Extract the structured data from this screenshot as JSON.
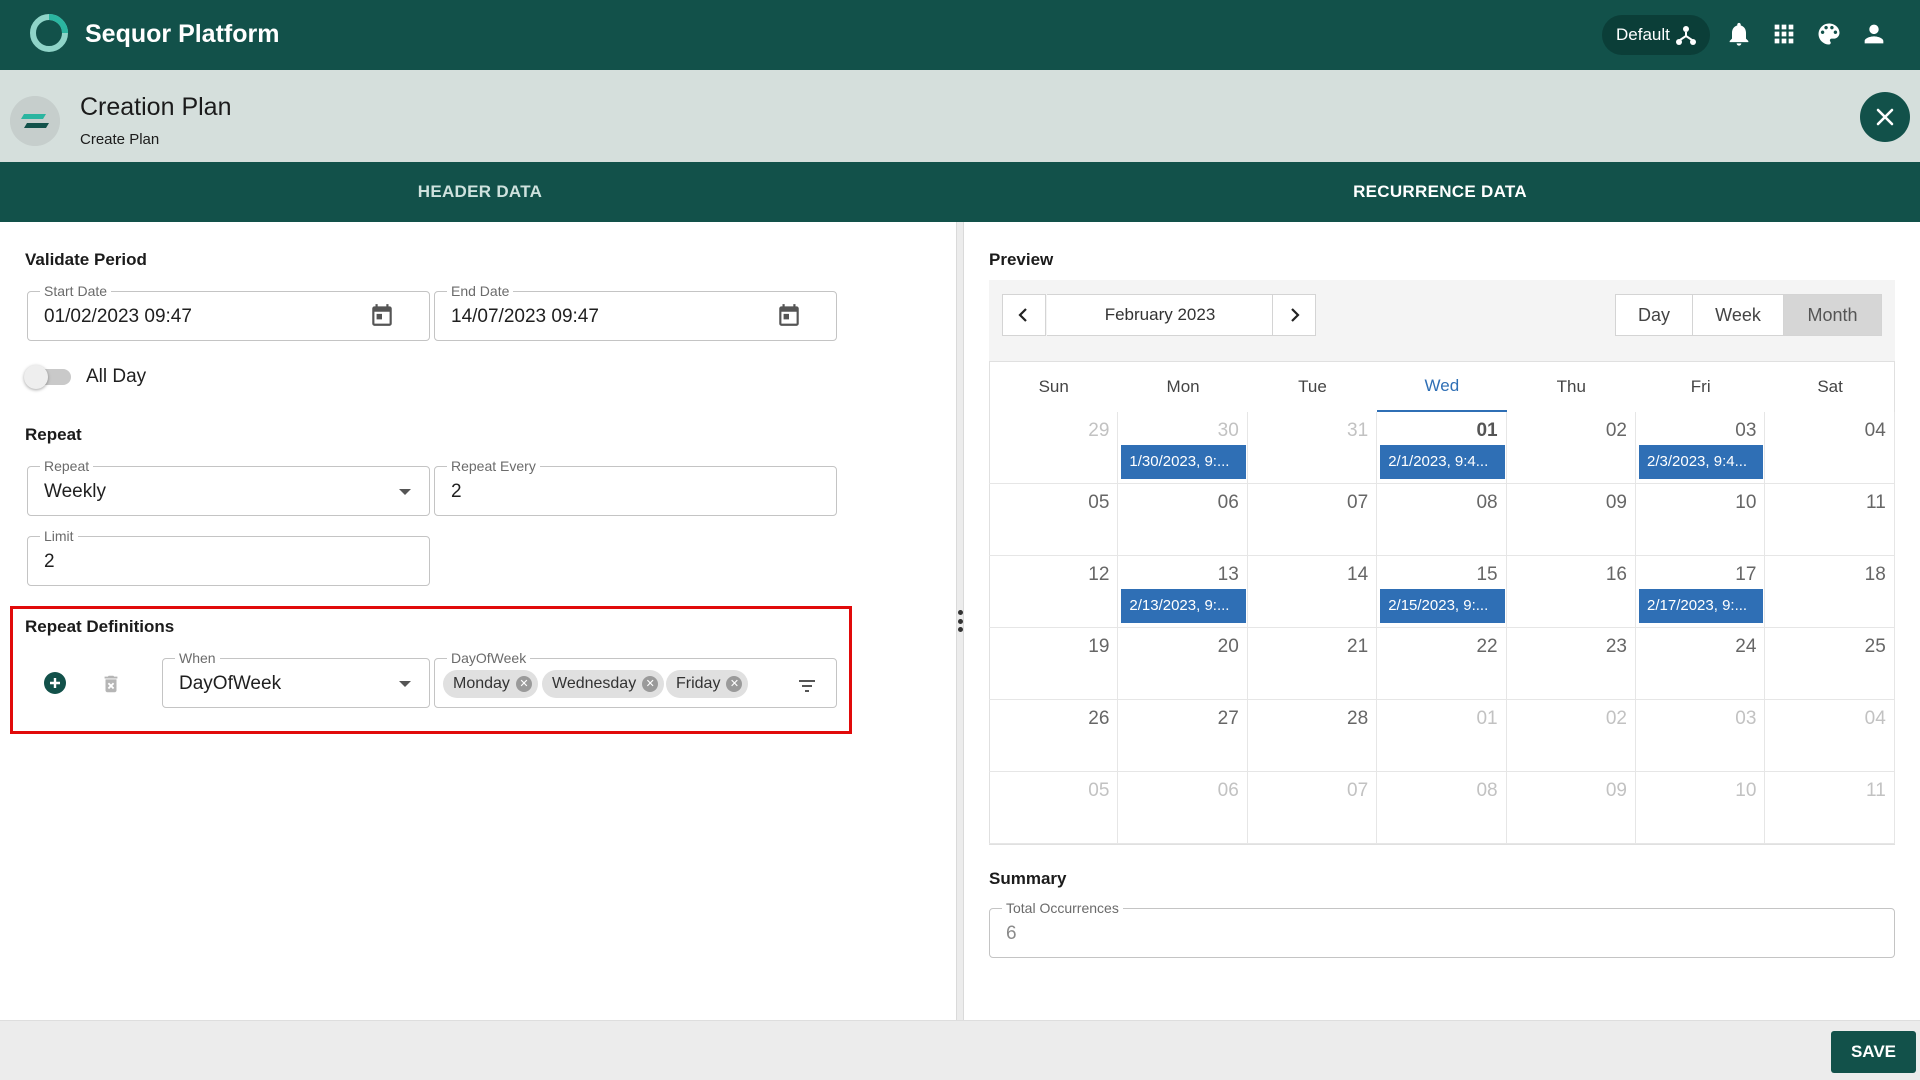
{
  "app": {
    "title": "Sequor Platform",
    "environment": "Default"
  },
  "header": {
    "title": "Creation Plan",
    "subtitle": "Create Plan"
  },
  "tabs": [
    {
      "label": "HEADER DATA"
    },
    {
      "label": "RECURRENCE DATA"
    }
  ],
  "left": {
    "validate_period": {
      "label": "Validate Period",
      "start_label": "Start Date",
      "start_value": "01/02/2023 09:47",
      "end_label": "End Date",
      "end_value": "14/07/2023 09:47"
    },
    "all_day": {
      "label": "All Day",
      "checked": false
    },
    "repeat": {
      "label": "Repeat",
      "repeat_label": "Repeat",
      "repeat_value": "Weekly",
      "every_label": "Repeat Every",
      "every_value": "2",
      "limit_label": "Limit",
      "limit_value": "2"
    },
    "definitions": {
      "label": "Repeat Definitions",
      "when_label": "When",
      "when_value": "DayOfWeek",
      "dow_label": "DayOfWeek",
      "chips": [
        "Monday",
        "Wednesday",
        "Friday"
      ]
    }
  },
  "preview": {
    "label": "Preview",
    "month": "February 2023",
    "views": [
      "Day",
      "Week",
      "Month"
    ],
    "active_view": "Month",
    "days_of_week": [
      "Sun",
      "Mon",
      "Tue",
      "Wed",
      "Thu",
      "Fri",
      "Sat"
    ],
    "weeks": [
      [
        "29",
        "30",
        "31",
        "01",
        "02",
        "03",
        "04"
      ],
      [
        "05",
        "06",
        "07",
        "08",
        "09",
        "10",
        "11"
      ],
      [
        "12",
        "13",
        "14",
        "15",
        "16",
        "17",
        "18"
      ],
      [
        "19",
        "20",
        "21",
        "22",
        "23",
        "24",
        "25"
      ],
      [
        "26",
        "27",
        "28",
        "01",
        "02",
        "03",
        "04"
      ],
      [
        "05",
        "06",
        "07",
        "08",
        "09",
        "10",
        "11"
      ]
    ],
    "events": [
      {
        "week": 0,
        "day": 1,
        "label": "1/30/2023, 9:..."
      },
      {
        "week": 0,
        "day": 3,
        "label": "2/1/2023, 9:4..."
      },
      {
        "week": 0,
        "day": 5,
        "label": "2/3/2023, 9:4..."
      },
      {
        "week": 2,
        "day": 1,
        "label": "2/13/2023, 9:..."
      },
      {
        "week": 2,
        "day": 3,
        "label": "2/15/2023, 9:..."
      },
      {
        "week": 2,
        "day": 5,
        "label": "2/17/2023, 9:..."
      }
    ]
  },
  "summary": {
    "label": "Summary",
    "total_label": "Total Occurrences",
    "total_value": "6"
  },
  "footer": {
    "save_label": "SAVE"
  },
  "colors": {
    "primary": "#12514a",
    "event": "#2f6fb5",
    "highlight": "#e10a0a"
  }
}
